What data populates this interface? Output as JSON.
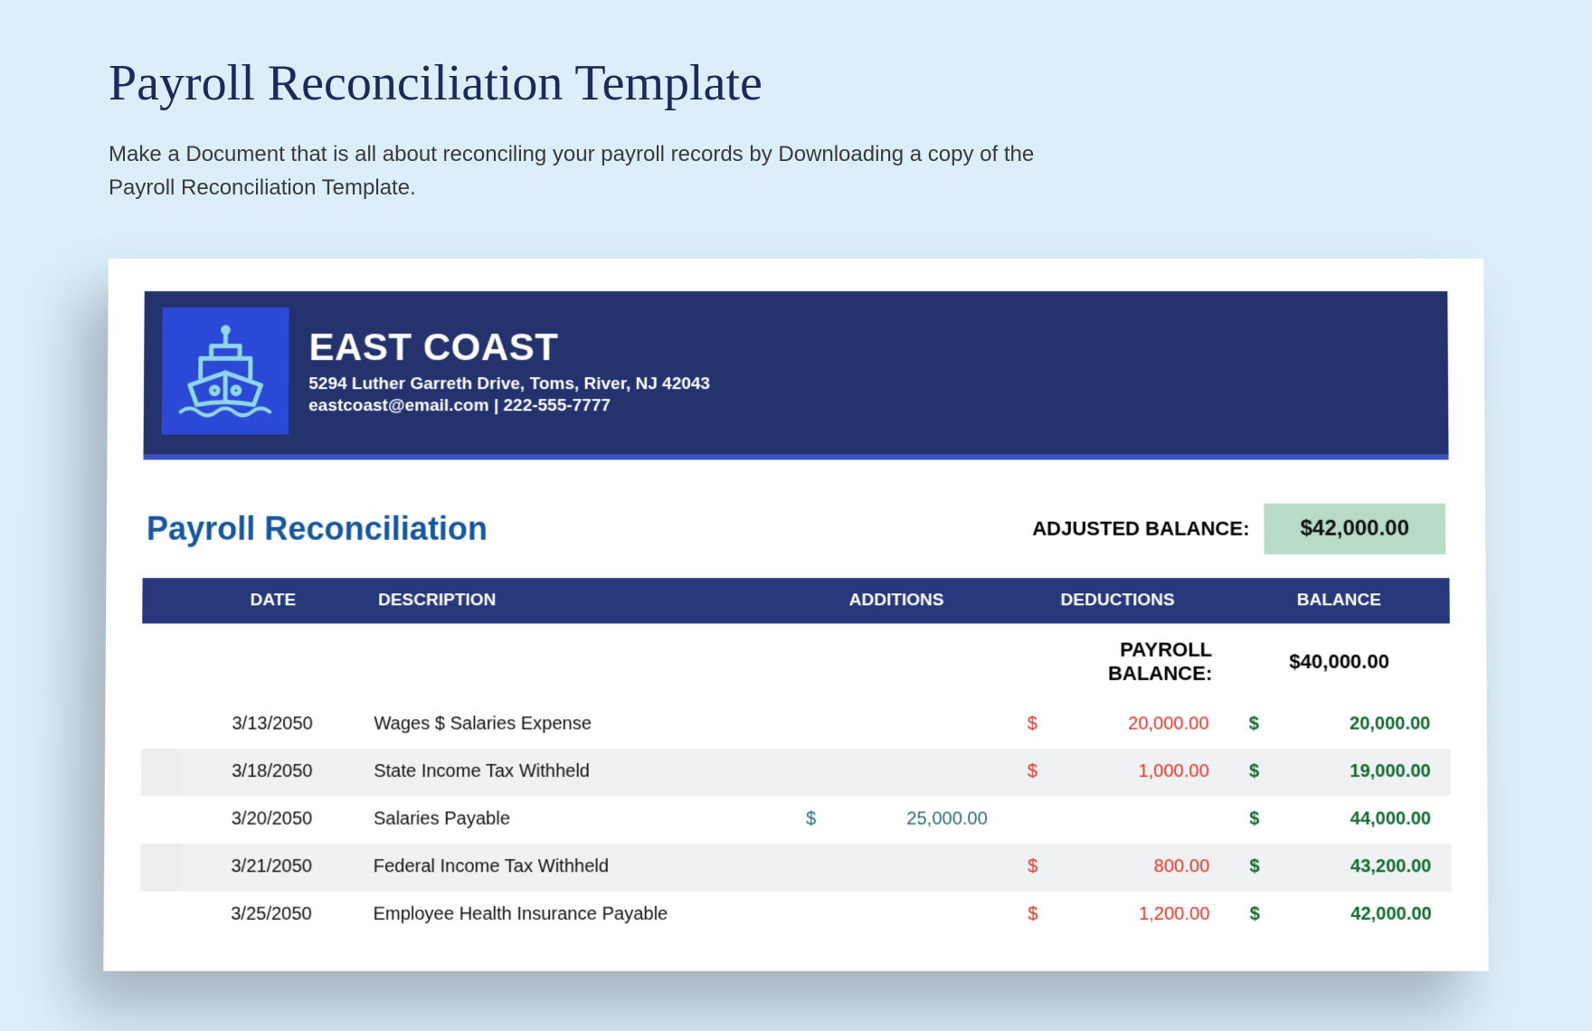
{
  "header": {
    "title": "Payroll Reconciliation Template",
    "description": "Make a Document that is all about reconciling your payroll records by Downloading a copy of the Payroll Reconciliation Template."
  },
  "company": {
    "name": "EAST COAST",
    "address": "5294 Luther Garreth Drive, Toms, River, NJ 42043",
    "contact": "eastcoast@email.com | 222-555-7777"
  },
  "section": {
    "title": "Payroll Reconciliation",
    "adjusted_label": "ADJUSTED BALANCE:",
    "adjusted_value": "$42,000.00"
  },
  "table": {
    "cols": {
      "date": "DATE",
      "desc": "DESCRIPTION",
      "add": "ADDITIONS",
      "ded": "DEDUCTIONS",
      "bal": "BALANCE"
    },
    "payroll_balance_label": "PAYROLL BALANCE:",
    "payroll_balance_value": "$40,000.00",
    "rows": [
      {
        "date": "3/13/2050",
        "desc": "Wages $ Salaries Expense",
        "add": "",
        "ded": "20,000.00",
        "bal": "20,000.00"
      },
      {
        "date": "3/18/2050",
        "desc": "State Income Tax Withheld",
        "add": "",
        "ded": "1,000.00",
        "bal": "19,000.00"
      },
      {
        "date": "3/20/2050",
        "desc": "Salaries Payable",
        "add": "25,000.00",
        "ded": "",
        "bal": "44,000.00"
      },
      {
        "date": "3/21/2050",
        "desc": "Federal Income Tax Withheld",
        "add": "",
        "ded": "800.00",
        "bal": "43,200.00"
      },
      {
        "date": "3/25/2050",
        "desc": "Employee Health Insurance Payable",
        "add": "",
        "ded": "1,200.00",
        "bal": "42,000.00"
      }
    ]
  },
  "currency_symbol": "$"
}
